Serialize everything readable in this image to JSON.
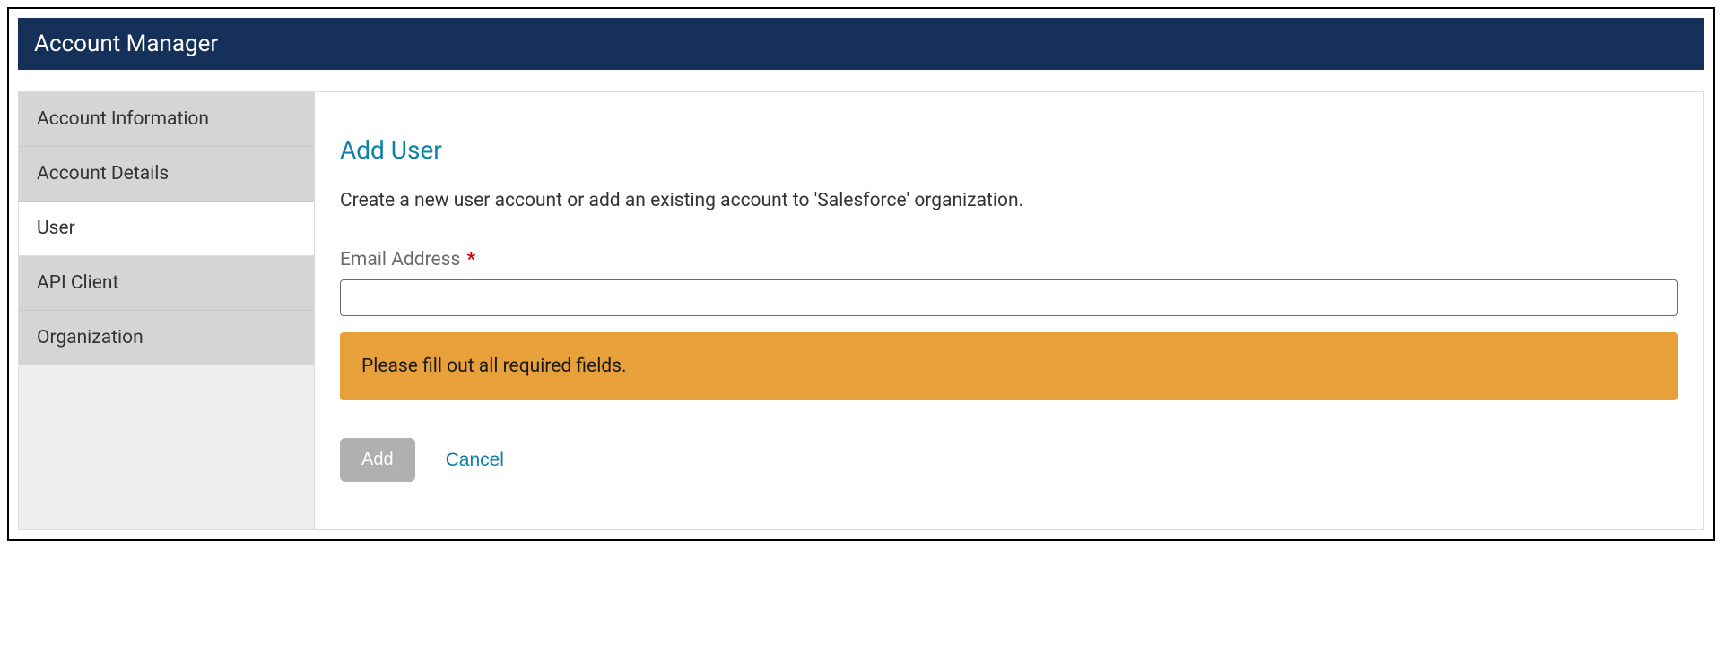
{
  "header": {
    "title": "Account Manager"
  },
  "sidebar": {
    "items": [
      {
        "label": "Account Information",
        "active": false
      },
      {
        "label": "Account Details",
        "active": false
      },
      {
        "label": "User",
        "active": true
      },
      {
        "label": "API Client",
        "active": false
      },
      {
        "label": "Organization",
        "active": false
      }
    ]
  },
  "main": {
    "title": "Add User",
    "description": "Create a new user account or add an existing account to 'Salesforce' organization.",
    "email_label": "Email Address",
    "required_marker": "*",
    "email_value": "",
    "alert_message": "Please fill out all required fields.",
    "add_button": "Add",
    "cancel_button": "Cancel"
  }
}
